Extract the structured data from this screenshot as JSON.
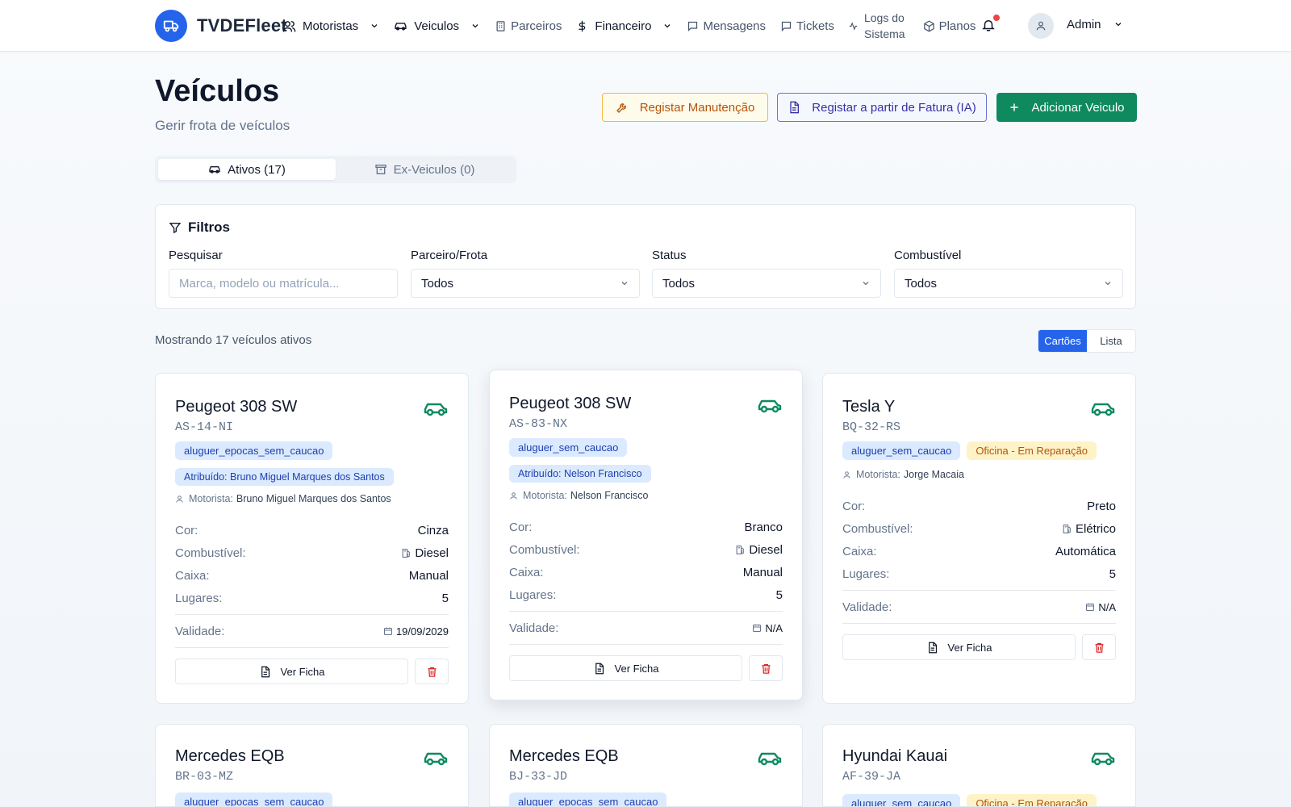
{
  "app": {
    "name": "TVDEFleet"
  },
  "nav": {
    "motoristas": "Motoristas",
    "veiculos": "Veiculos",
    "parceiros": "Parceiros",
    "financeiro": "Financeiro",
    "mensagens": "Mensagens",
    "tickets": "Tickets",
    "logs_line1": "Logs do",
    "logs_line2": "Sistema",
    "planos": "Planos",
    "user": "Admin"
  },
  "page": {
    "title": "Veículos",
    "subtitle": "Gerir frota de veículos",
    "btn_maintenance": "Registar Manutenção",
    "btn_invoice": "Registar a partir de Fatura (IA)",
    "btn_add": "Adicionar Veiculo"
  },
  "tabs": {
    "active": "Ativos (17)",
    "ex": "Ex-Veiculos (0)"
  },
  "filters": {
    "title": "Filtros",
    "search_label": "Pesquisar",
    "search_placeholder": "Marca, modelo ou matrícula...",
    "partner_label": "Parceiro/Frota",
    "partner_value": "Todos",
    "status_label": "Status",
    "status_value": "Todos",
    "fuel_label": "Combustível",
    "fuel_value": "Todos"
  },
  "results": {
    "showing": "Mostrando 17 veículos ativos",
    "view_cards": "Cartões",
    "view_list": "Lista"
  },
  "labels": {
    "cor": "Cor:",
    "combustivel": "Combustível:",
    "caixa": "Caixa:",
    "lugares": "Lugares:",
    "validade": "Validade:",
    "ver_ficha": "Ver Ficha",
    "motorista": "Motorista:"
  },
  "cards": [
    {
      "title": "Peugeot 308 SW",
      "plate": "AS-14-NI",
      "contract": "aluguer_epocas_sem_caucao",
      "assigned": "Atribuído: Bruno Miguel Marques dos Santos",
      "driver": "Bruno Miguel Marques dos Santos",
      "cor": "Cinza",
      "combustivel": "Diesel",
      "caixa": "Manual",
      "lugares": "5",
      "validade": "19/09/2029"
    },
    {
      "title": "Peugeot 308 SW",
      "plate": "AS-83-NX",
      "contract": "aluguer_sem_caucao",
      "assigned": "Atribuído: Nelson Francisco",
      "driver": "Nelson Francisco",
      "cor": "Branco",
      "combustivel": "Diesel",
      "caixa": "Manual",
      "lugares": "5",
      "validade": "N/A"
    },
    {
      "title": "Tesla Y",
      "plate": "BQ-32-RS",
      "contract": "aluguer_sem_caucao",
      "status": "Oficina - Em Reparação",
      "driver": "Jorge Macaia",
      "cor": "Preto",
      "combustivel": "Elétrico",
      "caixa": "Automática",
      "lugares": "5",
      "validade": "N/A"
    },
    {
      "title": "Mercedes EQB",
      "plate": "BR-03-MZ",
      "contract": "aluguer_epocas_sem_caucao"
    },
    {
      "title": "Mercedes EQB",
      "plate": "BJ-33-JD",
      "contract": "aluguer_epocas_sem_caucao"
    },
    {
      "title": "Hyundai Kauai",
      "plate": "AF-39-JA",
      "contract": "aluguer_sem_caucao",
      "status": "Oficina - Em Reparação"
    }
  ]
}
